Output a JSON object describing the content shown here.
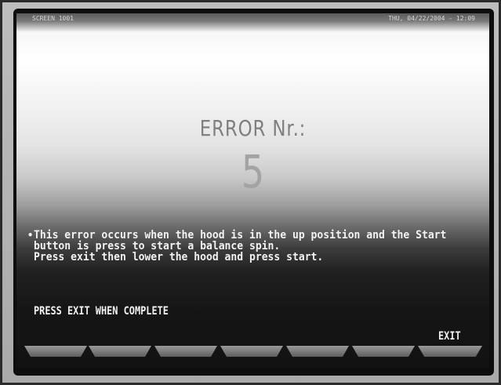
{
  "status_bar": {
    "screen_id": "SCREEN 1001",
    "datetime": "THU, 04/22/2004 - 12:09"
  },
  "error": {
    "title": "ERROR Nr.:",
    "code": "5"
  },
  "message": {
    "bullet": "•",
    "lines": [
      "This error occurs when the hood is in the up position and the Start",
      "button is press to start a balance spin.",
      "Press exit then lower the hood and press start."
    ]
  },
  "instruction": "PRESS EXIT WHEN COMPLETE",
  "softkeys": {
    "exit_label": "EXIT"
  }
}
